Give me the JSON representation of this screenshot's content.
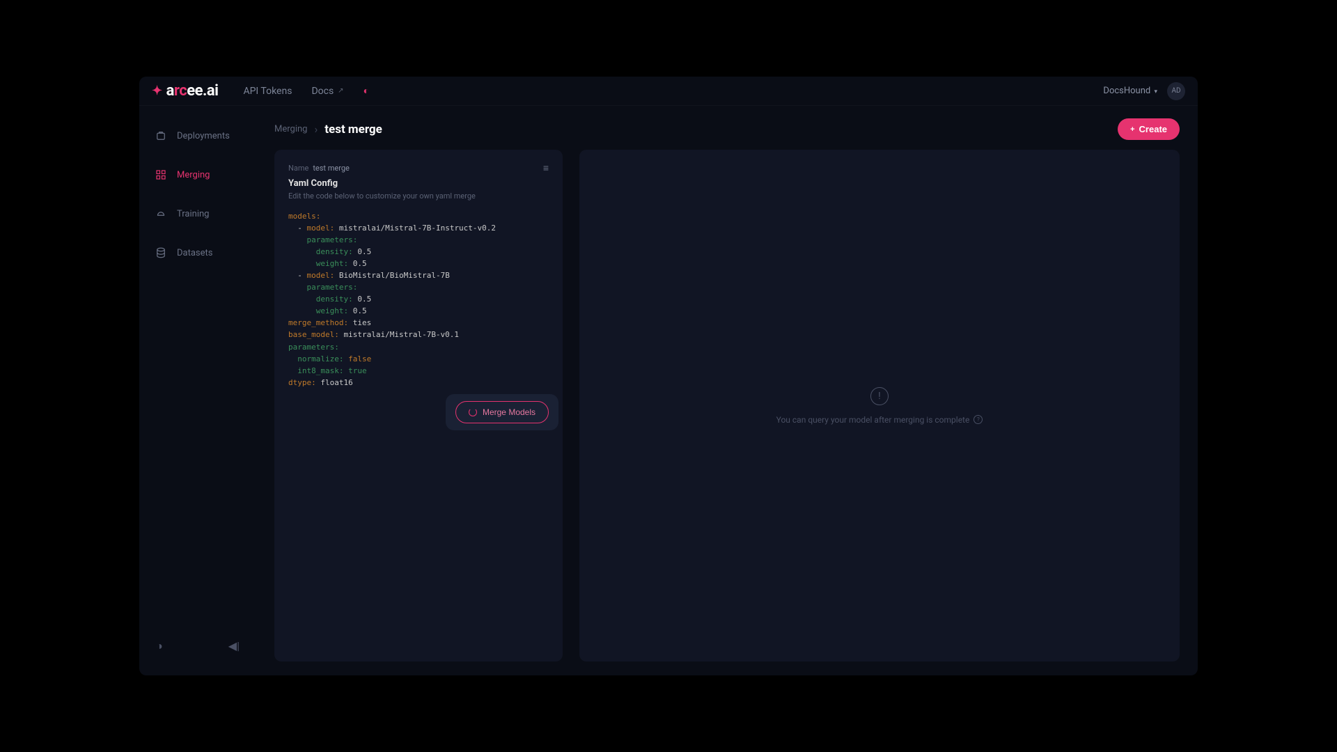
{
  "brand": {
    "name_a": "a",
    "name_b": "rc",
    "name_c": "ee.ai"
  },
  "nav": {
    "api_tokens": "API Tokens",
    "docs": "Docs",
    "workspace": "DocsHound",
    "avatar": "AD"
  },
  "sidebar": {
    "items": [
      {
        "label": "Deployments"
      },
      {
        "label": "Merging"
      },
      {
        "label": "Training"
      },
      {
        "label": "Datasets"
      }
    ]
  },
  "page": {
    "crumb": "Merging",
    "title": "test merge",
    "create": "Create"
  },
  "config_panel": {
    "name_label": "Name",
    "name_value": "test merge",
    "title": "Yaml Config",
    "subtitle": "Edit the code below to customize your own yaml merge",
    "merge_button": "Merge Models"
  },
  "yaml": {
    "models_key": "models:",
    "model_key": "model:",
    "model_1": "mistralai/Mistral-7B-Instruct-v0.2",
    "params_key": "parameters:",
    "density_key": "density:",
    "density_val": "0.5",
    "weight_key": "weight:",
    "weight_val": "0.5",
    "model_2": "BioMistral/BioMistral-7B",
    "merge_method_key": "merge_method:",
    "merge_method_val": "ties",
    "base_model_key": "base_model:",
    "base_model_val": "mistralai/Mistral-7B-v0.1",
    "normalize_key": "normalize:",
    "normalize_val": "false",
    "int8_mask_key": "int8_mask:",
    "int8_mask_val": "true",
    "dtype_key": "dtype:",
    "dtype_val": "float16"
  },
  "right_panel": {
    "message": "You can query your model after merging is complete"
  }
}
